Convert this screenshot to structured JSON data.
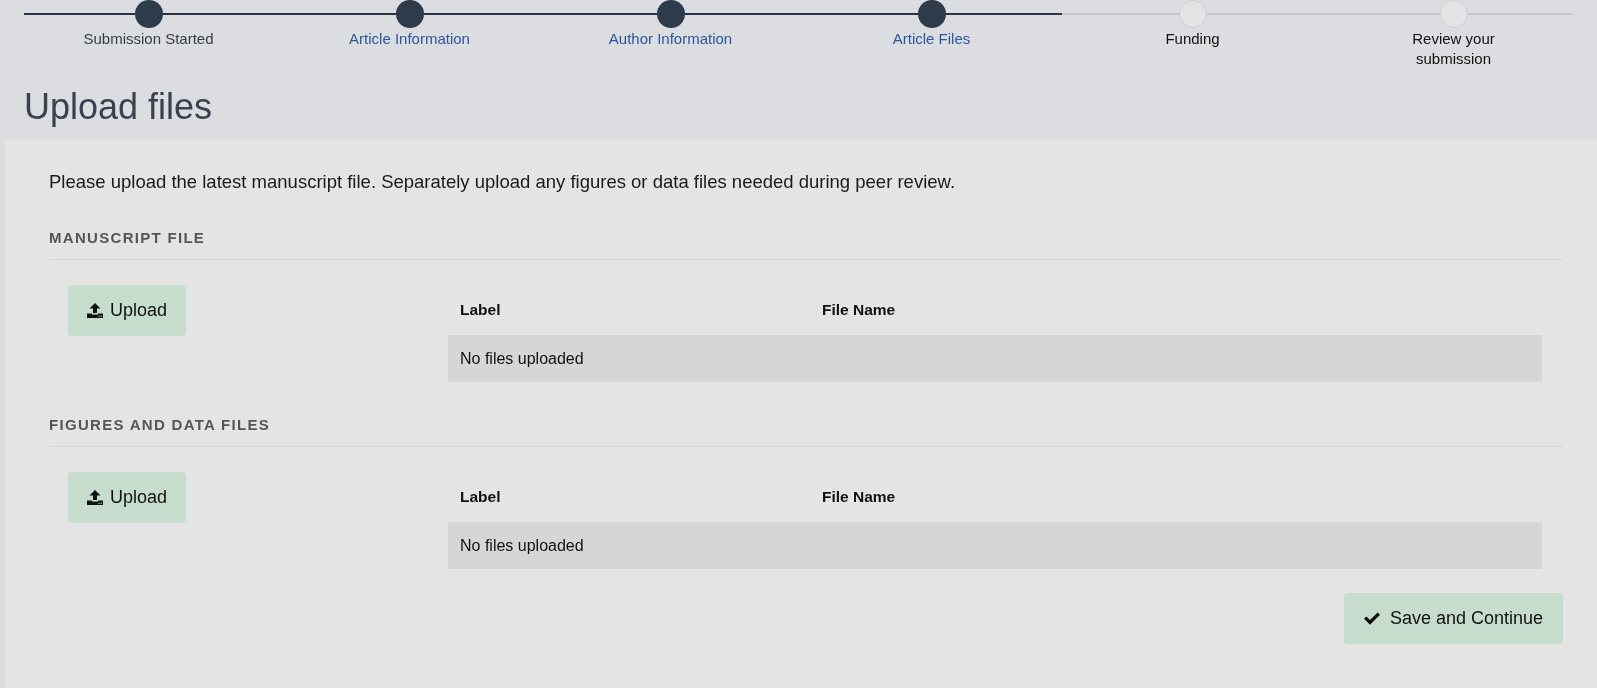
{
  "progress_steps": [
    {
      "label": "Submission Started",
      "completed": true,
      "linked": false
    },
    {
      "label": "Article Information",
      "completed": true,
      "linked": true
    },
    {
      "label": "Author Information",
      "completed": true,
      "linked": true
    },
    {
      "label": "Article Files",
      "completed": true,
      "linked": true
    },
    {
      "label": "Funding",
      "completed": false,
      "linked": false
    },
    {
      "label": "Review your submission",
      "completed": false,
      "linked": false
    }
  ],
  "page_title": "Upload files",
  "instructions": "Please upload the latest manuscript file. Separately upload any figures or data files needed during peer review.",
  "sections": [
    {
      "heading": "MANUSCRIPT FILE",
      "upload_button": "Upload",
      "table": {
        "columns": [
          "Label",
          "File Name"
        ],
        "empty_message": "No files uploaded"
      }
    },
    {
      "heading": "FIGURES AND DATA FILES",
      "upload_button": "Upload",
      "table": {
        "columns": [
          "Label",
          "File Name"
        ],
        "empty_message": "No files uploaded"
      }
    }
  ],
  "save_button": "Save and Continue"
}
